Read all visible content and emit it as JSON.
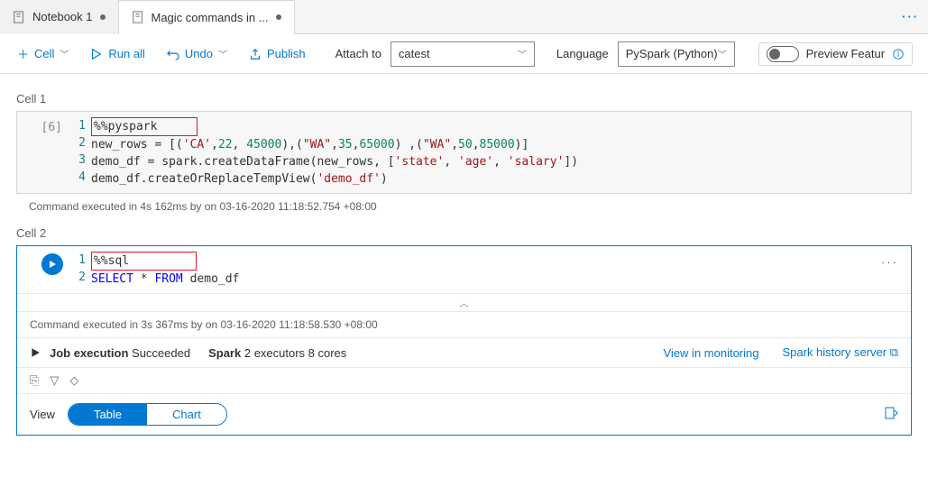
{
  "tabs": {
    "tab1": "Notebook 1",
    "tab2": "Magic commands in ..."
  },
  "toolbar": {
    "cell": "Cell",
    "run_all": "Run all",
    "undo": "Undo",
    "publish": "Publish",
    "attach_to": "Attach to",
    "attach_value": "catest",
    "language": "Language",
    "language_value": "PySpark (Python)",
    "preview": "Preview Featur"
  },
  "cell1": {
    "label": "Cell 1",
    "exec": "[6]",
    "lines": {
      "l1": "1",
      "l2": "2",
      "l3": "3",
      "l4": "4"
    },
    "magic": "%%pyspark",
    "l2a": "new_rows = [(",
    "l2s1": "'CA'",
    "l2c1": ",",
    "l2n1": "22",
    "l2c2": ", ",
    "l2n2": "45000",
    "l2b": "),(",
    "l2s2": "\"WA\"",
    "l2c3": ",",
    "l2n3": "35",
    "l2c4": ",",
    "l2n4": "65000",
    "l2c5": ") ,(",
    "l2s3": "\"WA\"",
    "l2c6": ",",
    "l2n5": "50",
    "l2c7": ",",
    "l2n6": "85000",
    "l2end": ")]",
    "l3a": "demo_df = spark.createDataFrame(new_rows, [",
    "l3s1": "'state'",
    "l3c1": ", ",
    "l3s2": "'age'",
    "l3c2": ", ",
    "l3s3": "'salary'",
    "l3end": "])",
    "l4a": "demo_df.createOrReplaceTempView(",
    "l4s1": "'demo_df'",
    "l4end": ")",
    "status": "Command executed in 4s 162ms by       on 03-16-2020 11:18:52.754 +08:00"
  },
  "cell2": {
    "label": "Cell 2",
    "lines": {
      "l1": "1",
      "l2": "2"
    },
    "magic": "%%sql",
    "kw1": "SELECT",
    "star": " * ",
    "kw2": "FROM",
    "tbl": " demo_df",
    "collapse": "︿",
    "status": "Command executed in 3s 367ms by       on 03-16-2020 11:18:58.530 +08:00",
    "job_label": "Job execution",
    "job_status": " Succeeded",
    "spark_label": "Spark",
    "spark_info": " 2 executors 8 cores",
    "view_monitoring": "View in monitoring",
    "spark_history": "Spark history server",
    "view": "View",
    "table": "Table",
    "chart": "Chart"
  }
}
